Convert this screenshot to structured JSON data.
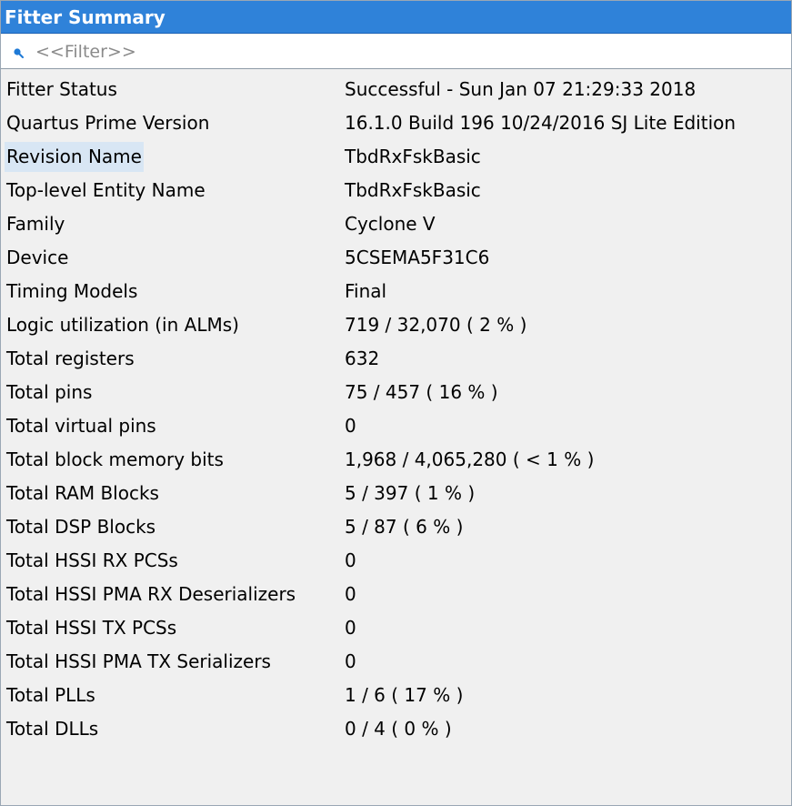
{
  "window": {
    "title": "Fitter Summary"
  },
  "filter": {
    "placeholder": "<<Filter>>",
    "value": "",
    "icon": "search-icon"
  },
  "colors": {
    "title_bg": "#2f82d9",
    "selected_bg": "#d8e6f4",
    "table_bg": "#f0f0f0"
  },
  "selected_row": "Revision Name",
  "rows": [
    {
      "name": "Fitter Status",
      "value": "Successful - Sun Jan 07 21:29:33 2018"
    },
    {
      "name": "Quartus Prime Version",
      "value": "16.1.0 Build 196 10/24/2016 SJ Lite Edition"
    },
    {
      "name": "Revision Name",
      "value": "TbdRxFskBasic"
    },
    {
      "name": "Top-level Entity Name",
      "value": "TbdRxFskBasic"
    },
    {
      "name": "Family",
      "value": "Cyclone V"
    },
    {
      "name": "Device",
      "value": "5CSEMA5F31C6"
    },
    {
      "name": "Timing Models",
      "value": "Final"
    },
    {
      "name": "Logic utilization (in ALMs)",
      "value": "719 / 32,070 ( 2 % )"
    },
    {
      "name": "Total registers",
      "value": "632"
    },
    {
      "name": "Total pins",
      "value": "75 / 457 ( 16 % )"
    },
    {
      "name": "Total virtual pins",
      "value": "0"
    },
    {
      "name": "Total block memory bits",
      "value": "1,968 / 4,065,280 ( < 1 % )"
    },
    {
      "name": "Total RAM Blocks",
      "value": "5 / 397 ( 1 % )"
    },
    {
      "name": "Total DSP Blocks",
      "value": "5 / 87 ( 6 % )"
    },
    {
      "name": "Total HSSI RX PCSs",
      "value": "0"
    },
    {
      "name": "Total HSSI PMA RX Deserializers",
      "value": "0"
    },
    {
      "name": "Total HSSI TX PCSs",
      "value": "0"
    },
    {
      "name": "Total HSSI PMA TX Serializers",
      "value": "0"
    },
    {
      "name": "Total PLLs",
      "value": "1 / 6 ( 17 % )"
    },
    {
      "name": "Total DLLs",
      "value": "0 / 4 ( 0 % )"
    }
  ]
}
